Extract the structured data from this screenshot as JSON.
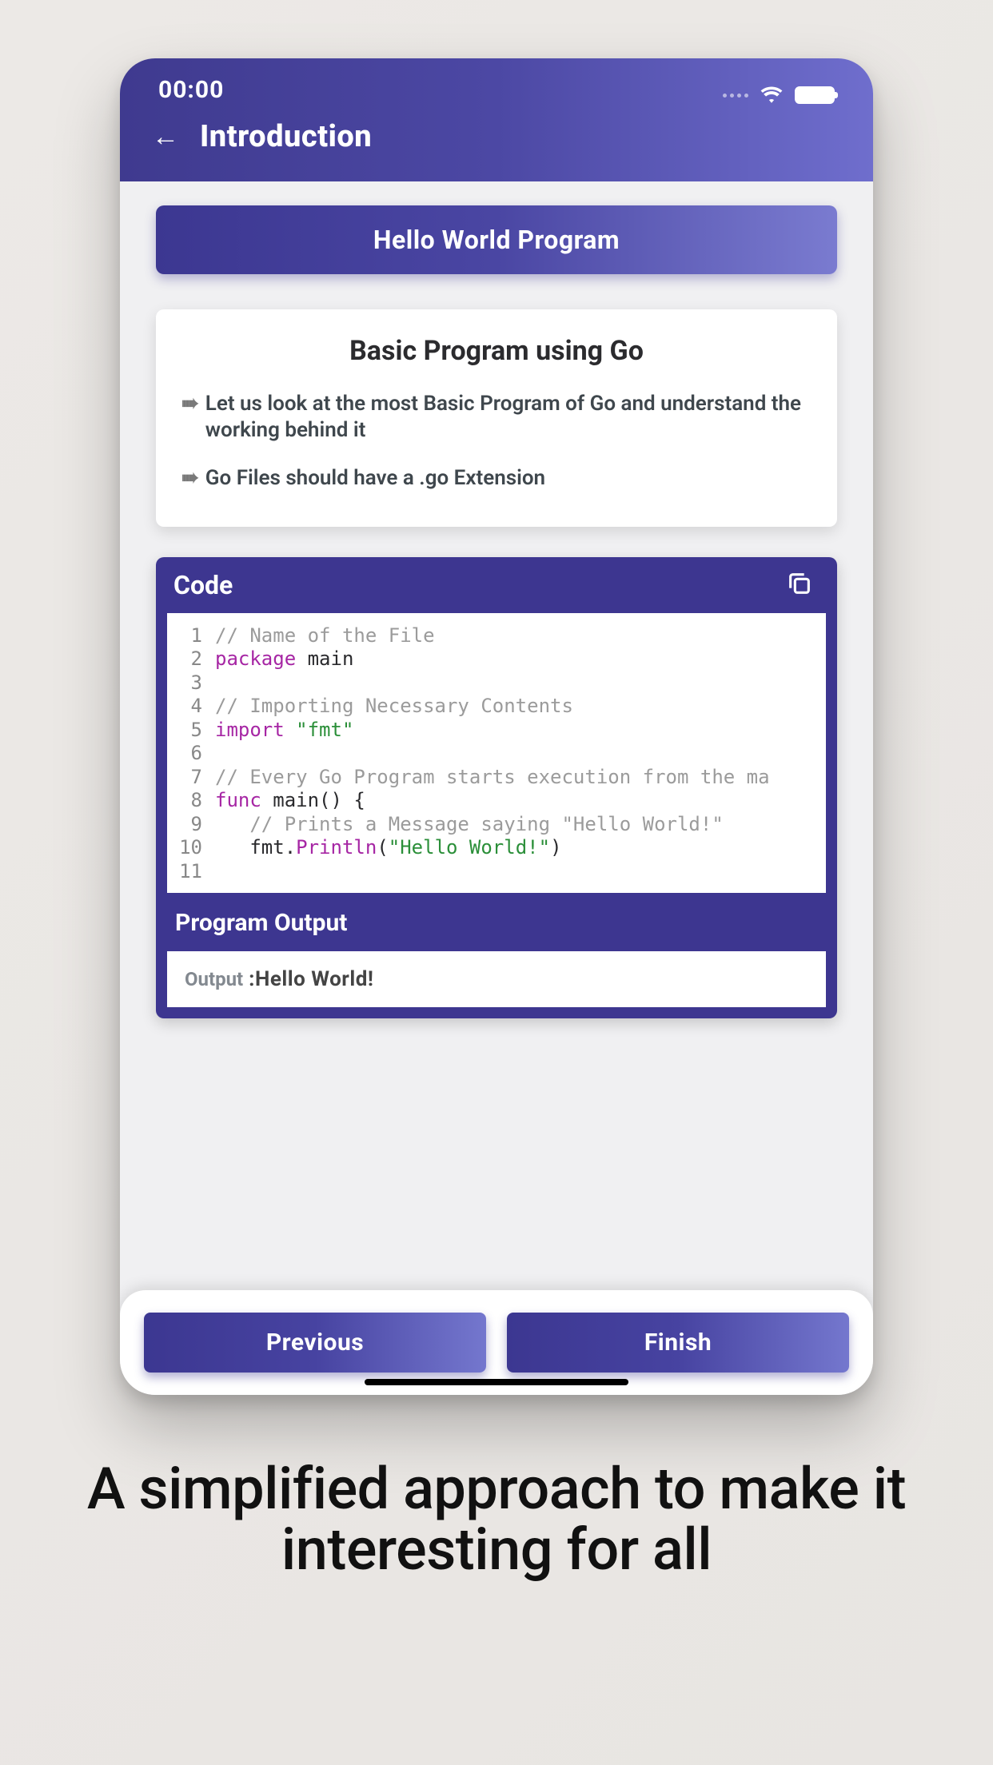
{
  "status": {
    "time": "00:00"
  },
  "header": {
    "title": "Introduction"
  },
  "banner": {
    "title": "Hello World Program"
  },
  "info": {
    "title": "Basic Program using Go",
    "bullets": [
      "Let us look at the most Basic Program of Go and understand the working behind it",
      "Go Files should have a .go Extension"
    ]
  },
  "code": {
    "title": "Code",
    "lines": [
      {
        "n": 1,
        "text": "// Name of the File",
        "type": "comment"
      },
      {
        "n": 2,
        "kw": "package",
        "rest": " main"
      },
      {
        "n": 3,
        "text": ""
      },
      {
        "n": 4,
        "text": "// Importing Necessary Contents",
        "type": "comment"
      },
      {
        "n": 5,
        "kw": "import",
        "str": " \"fmt\""
      },
      {
        "n": 6,
        "text": ""
      },
      {
        "n": 7,
        "text": "// Every Go Program starts execution from the ma",
        "type": "comment"
      },
      {
        "n": 8,
        "kw": "func",
        "rest": " main() {"
      },
      {
        "n": 9,
        "text": "   // Prints a Message saying \"Hello World!\"",
        "type": "comment"
      },
      {
        "n": 10,
        "pre": "   fmt.",
        "fn": "Println",
        "mid": "(",
        "str": "\"Hello World!\"",
        "post": ")"
      },
      {
        "n": 11,
        "text": ""
      }
    ]
  },
  "output": {
    "title": "Program Output",
    "label": "Output",
    "value": "Hello World!"
  },
  "nav": {
    "prev": "Previous",
    "next": "Finish"
  },
  "tagline": "A simplified approach to make it interesting for all"
}
